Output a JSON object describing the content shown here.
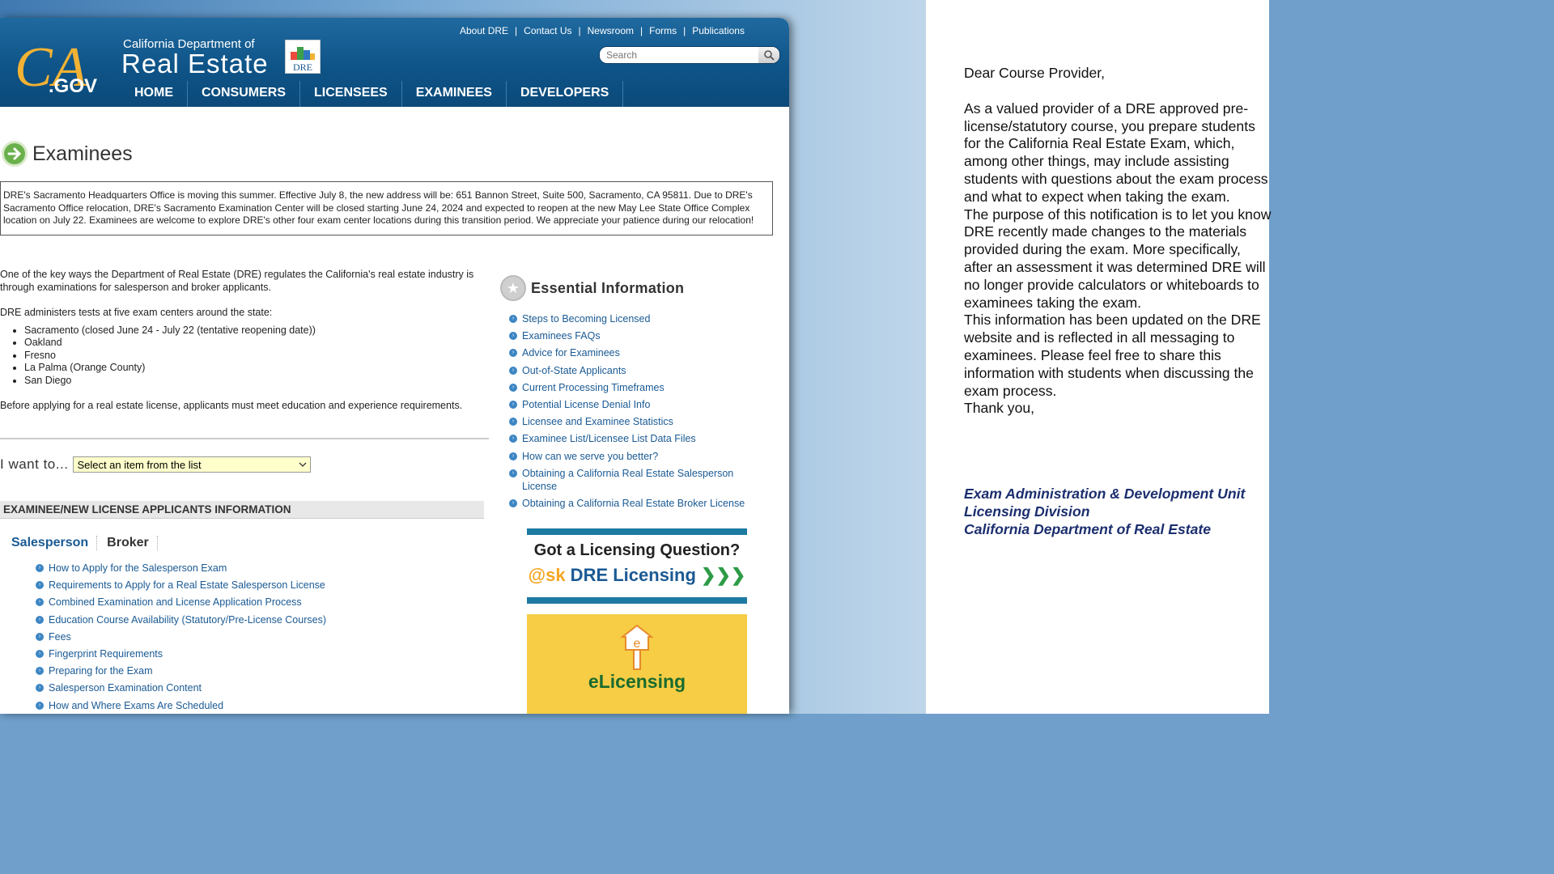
{
  "site": {
    "logo_text": "CA.GOV",
    "dept_small": "California Department of",
    "dept_big": "Real Estate",
    "dre_logo_text": "DRE"
  },
  "util_nav": [
    "About DRE",
    "Contact Us",
    "Newsroom",
    "Forms",
    "Publications"
  ],
  "search": {
    "placeholder": "Search"
  },
  "main_nav": [
    "HOME",
    "CONSUMERS",
    "LICENSEES",
    "EXAMINEES",
    "DEVELOPERS"
  ],
  "page_title": "Examinees",
  "notice": "DRE's Sacramento Headquarters Office is moving this summer. Effective July 8, the new address will be: 651 Bannon Street, Suite 500, Sacramento, CA 95811. Due to DRE's Sacramento Office relocation, DRE's Sacramento Examination Center will be closed starting June 24, 2024 and expected to reopen at the new May Lee State Office Complex location on July 22. Examinees are welcome to explore DRE's other four exam center locations during this transition period. We appreciate your patience during our relocation!",
  "intro": {
    "p1": "One of the key ways the Department of Real Estate (DRE) regulates the California's real estate industry is through examinations for salesperson and broker applicants.",
    "p2": "DRE administers tests at five exam centers around the state:",
    "centers": [
      "Sacramento (closed June 24 - July 22 (tentative reopening date))",
      "Oakland",
      "Fresno",
      "La Palma (Orange County)",
      "San Diego"
    ],
    "p3": "Before applying for a real estate license, applicants must meet education and experience requirements."
  },
  "iwant": {
    "label": "I want to...",
    "selected": "Select an item from the list"
  },
  "section_header": "EXAMINEE/NEW LICENSE APPLICANTS INFORMATION",
  "tabs": [
    "Salesperson",
    "Broker"
  ],
  "salesperson_links": [
    "How to Apply for the Salesperson Exam",
    "Requirements to Apply for a Real Estate Salesperson License",
    "Combined Examination and License Application Process",
    "Education Course Availability (Statutory/Pre-License Courses)",
    "Fees",
    "Fingerprint Requirements",
    "Preparing for the Exam",
    "Salesperson Examination Content",
    "How and Where Exams Are Scheduled"
  ],
  "essential": {
    "title": "Essential Information",
    "links": [
      "Steps to Becoming Licensed",
      "Examinees FAQs",
      "Advice for Examinees",
      "Out-of-State Applicants",
      "Current Processing Timeframes",
      "Potential License Denial Info",
      "Licensee and Examinee Statistics",
      "Examinee List/Licensee List Data Files",
      "How can we serve you better?",
      "Obtaining a California Real Estate Salesperson License",
      "Obtaining a California Real Estate Broker License"
    ]
  },
  "banner": {
    "question": "Got a Licensing Question?",
    "ask_at": "@sk",
    "ask_dre": " DRE Licensing",
    "ask_chevrons": "❯❯❯",
    "elicensing": "eLicensing"
  },
  "letter": {
    "greeting": "Dear Course Provider,",
    "p1": "As a valued provider of a DRE approved pre-license/statutory course, you prepare students for the California Real Estate Exam, which, among other things, may include assisting students with questions about the exam process and what to expect when taking the exam.",
    "p2": "The purpose of this notification is to let you know DRE recently made changes to the materials provided during the exam.  More specifically, after an assessment it was determined DRE will no longer provide calculators or whiteboards to examinees taking the exam.",
    "p3": "This information has been updated on the DRE website and is reflected in all messaging to examinees.  Please feel free to share this information with students when discussing the exam process.",
    "closing": "Thank you,",
    "sig_line1": "Exam Administration & Development Unit",
    "sig_line2": "Licensing Division",
    "sig_line3": "California Department of Real Estate"
  },
  "colors": {
    "header_blue": "#0f5488",
    "link_blue": "#1a5a94",
    "signature_navy": "#1b2e6e",
    "select_bg": "#ffffcc"
  }
}
